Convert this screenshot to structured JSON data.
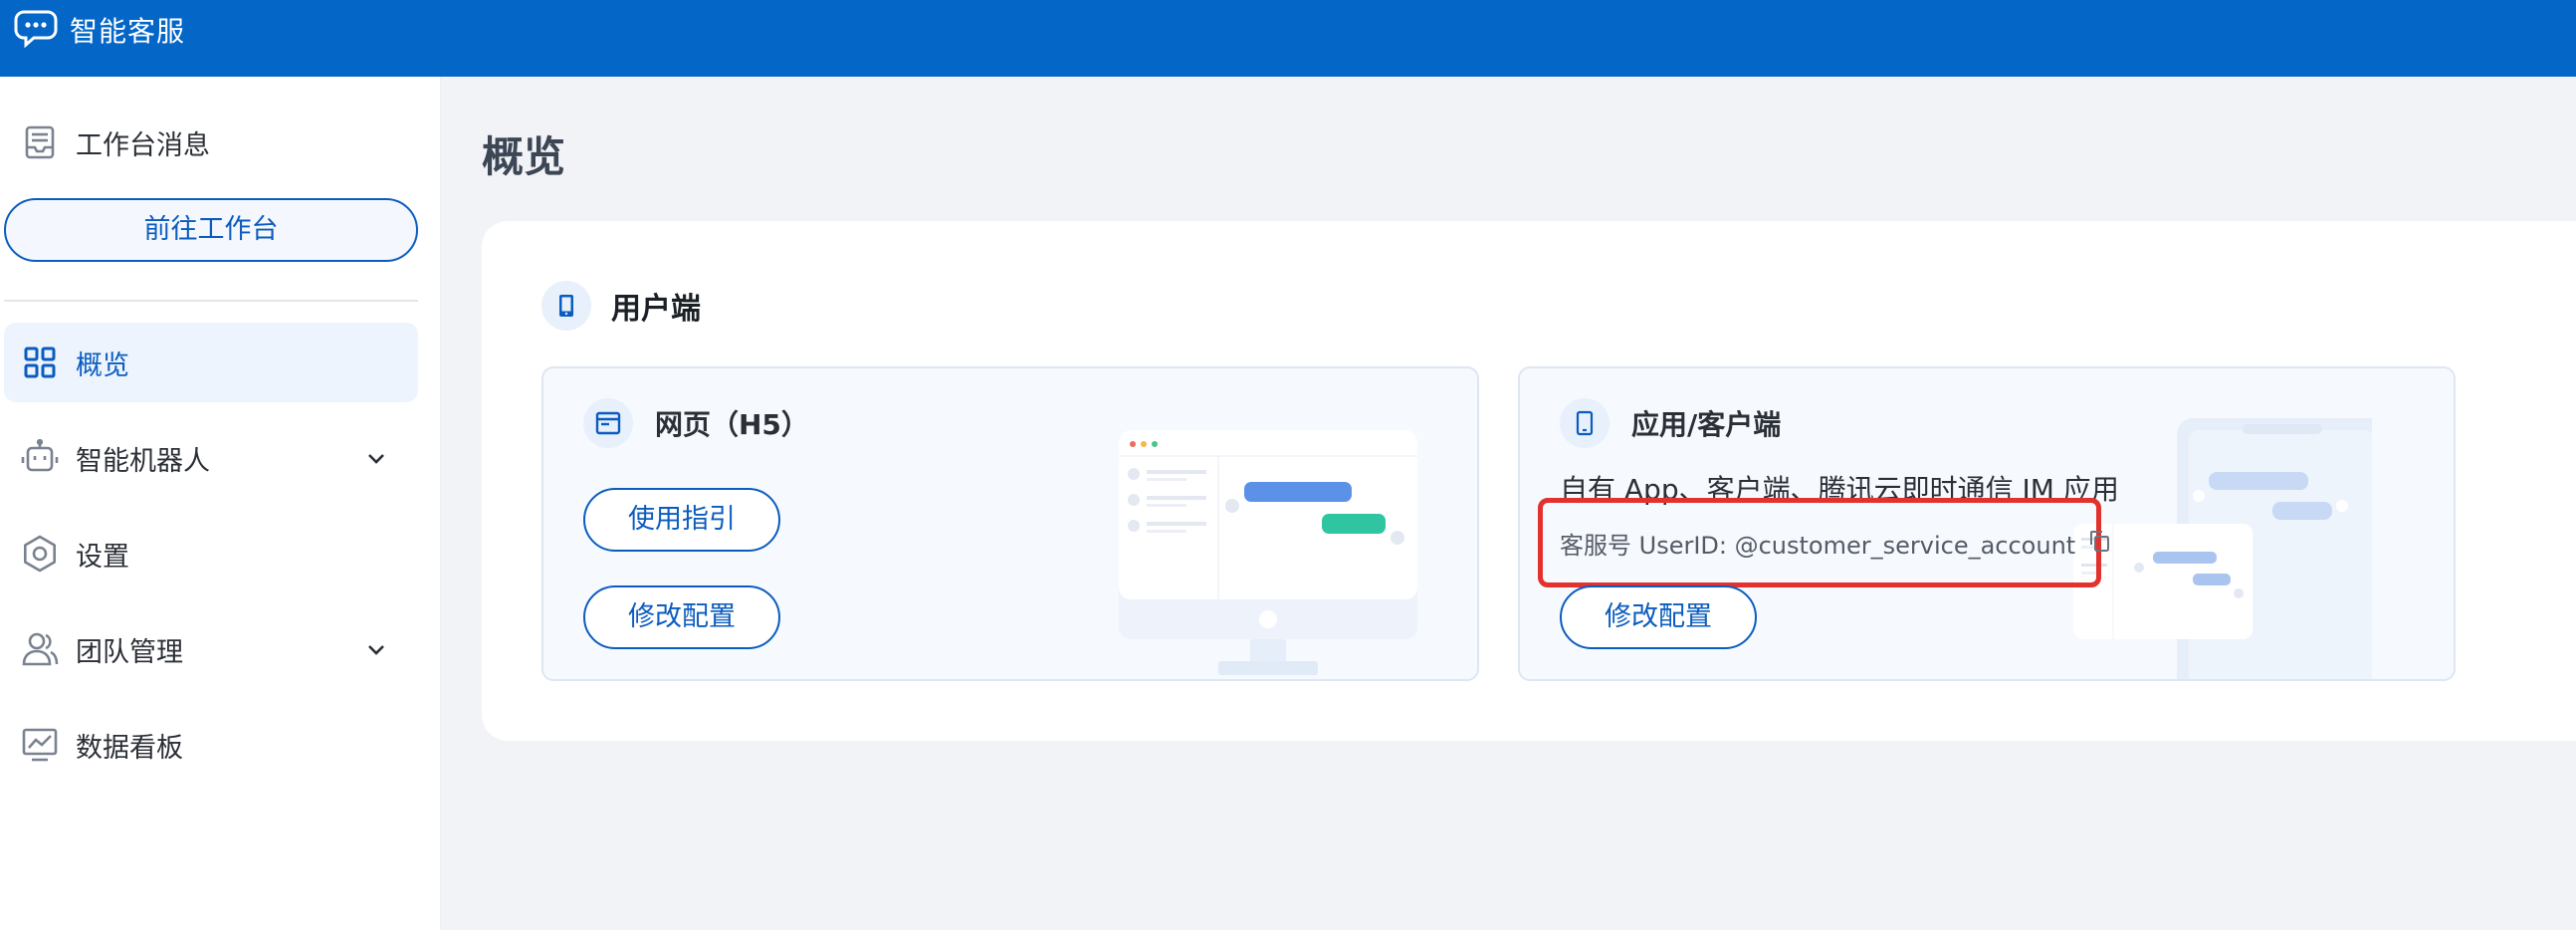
{
  "app": {
    "title": "智能客服"
  },
  "sidebar": {
    "workbench_messages": "工作台消息",
    "goto_workbench": "前往工作台",
    "items": [
      {
        "label": "概览",
        "active": true
      },
      {
        "label": "智能机器人",
        "expandable": true
      },
      {
        "label": "设置"
      },
      {
        "label": "团队管理",
        "expandable": true
      },
      {
        "label": "数据看板"
      }
    ]
  },
  "main": {
    "title": "概览",
    "section": {
      "title": "用户端",
      "cards": [
        {
          "title": "网页（H5）",
          "buttons": [
            "使用指引",
            "修改配置"
          ]
        },
        {
          "title": "应用/客户端",
          "description": "自有 App、客户端、腾讯云即时通信 IM 应用",
          "userid_label": "客服号 UserID: @customer_service_account",
          "buttons": [
            "修改配置"
          ]
        }
      ]
    }
  },
  "colors": {
    "primary": "#0466c7",
    "accent": "#0b5cbf",
    "highlight": "#e3322d"
  },
  "icons": [
    "chat-bubble-icon",
    "inbox-icon",
    "grid-icon",
    "robot-icon",
    "gear-icon",
    "user-icon",
    "chart-board-icon",
    "chevron-down-icon",
    "phone-icon",
    "browser-window-icon",
    "tablet-icon",
    "copy-icon"
  ]
}
